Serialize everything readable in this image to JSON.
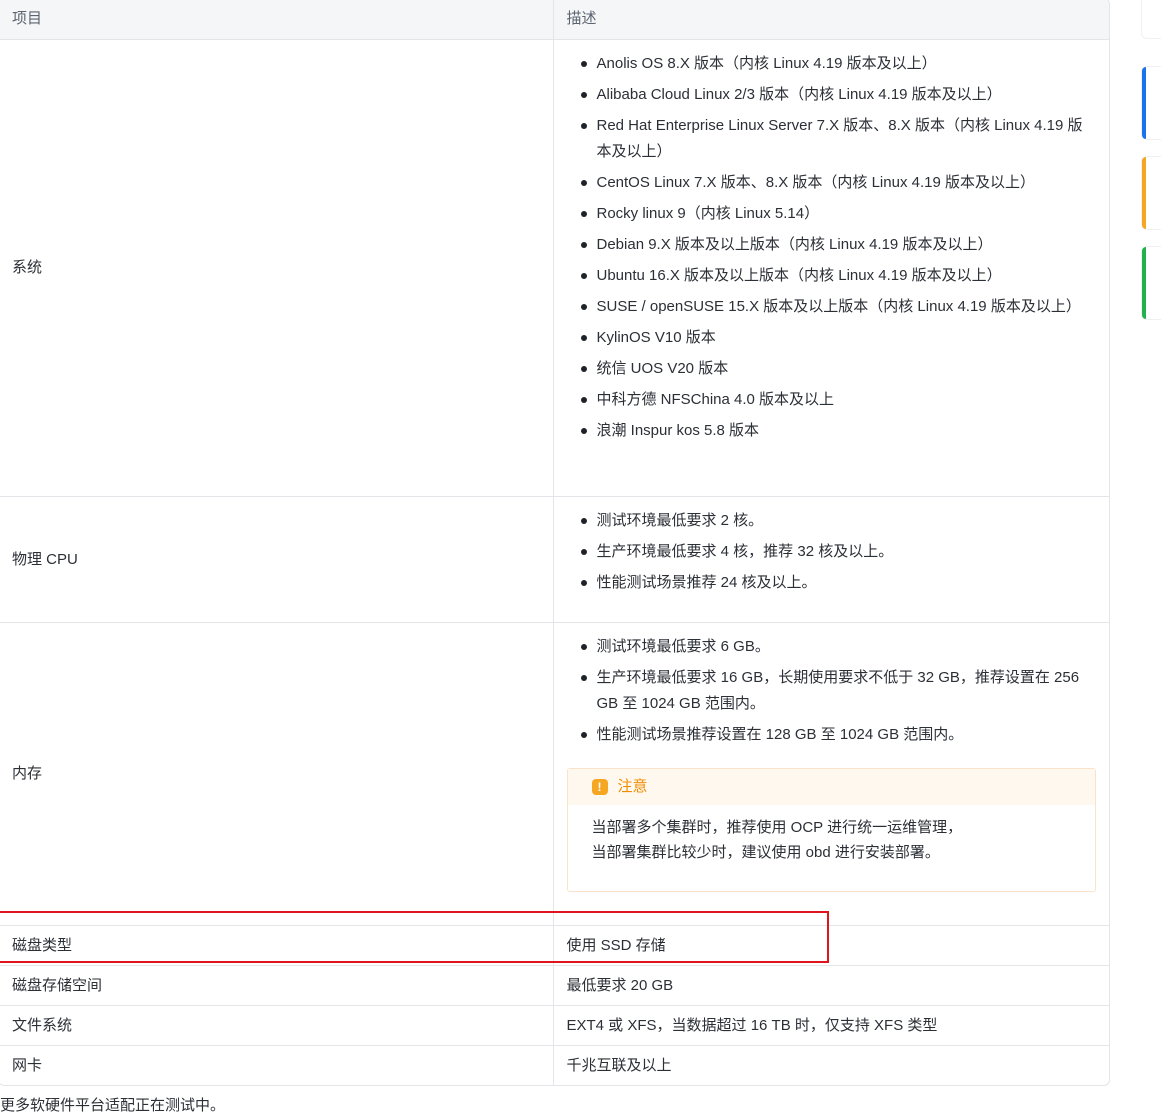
{
  "table": {
    "headers": [
      "项目",
      "描述"
    ],
    "system": {
      "label": "系统",
      "items": [
        "Anolis OS 8.X 版本（内核 Linux 4.19 版本及以上）",
        "Alibaba Cloud Linux 2/3 版本（内核 Linux 4.19 版本及以上）",
        "Red Hat Enterprise Linux Server 7.X 版本、8.X 版本（内核 Linux 4.19 版本及以上）",
        "CentOS Linux 7.X 版本、8.X 版本（内核 Linux 4.19 版本及以上）",
        "Rocky linux 9（内核 Linux 5.14）",
        "Debian 9.X 版本及以上版本（内核 Linux 4.19 版本及以上）",
        "Ubuntu 16.X 版本及以上版本（内核 Linux 4.19 版本及以上）",
        "SUSE / openSUSE 15.X 版本及以上版本（内核 Linux 4.19 版本及以上）",
        "KylinOS V10 版本",
        "统信 UOS V20 版本",
        "中科方德 NFSChina 4.0 版本及以上",
        "浪潮 Inspur kos 5.8 版本"
      ]
    },
    "cpu": {
      "label": "物理 CPU",
      "items": [
        "测试环境最低要求 2 核。",
        "生产环境最低要求 4 核，推荐 32 核及以上。",
        "性能测试场景推荐 24 核及以上。"
      ]
    },
    "memory": {
      "label": "内存",
      "items": [
        "测试环境最低要求 6 GB。",
        "生产环境最低要求 16 GB，长期使用要求不低于 32 GB，推荐设置在 256 GB 至 1024 GB 范围内。",
        "性能测试场景推荐设置在 128 GB 至 1024 GB 范围内。"
      ],
      "notice": {
        "title": "注意",
        "icon": "!",
        "lines": [
          "当部署多个集群时，推荐使用 OCP 进行统一运维管理，",
          "当部署集群比较少时，建议使用 obd 进行安装部署。"
        ]
      }
    },
    "simple_rows": [
      {
        "label": "磁盘类型",
        "value": "使用 SSD 存储"
      },
      {
        "label": "磁盘存储空间",
        "value": "最低要求 20 GB"
      },
      {
        "label": "文件系统",
        "value": "EXT4 或 XFS，当数据超过 16 TB 时，仅支持 XFS 类型"
      },
      {
        "label": "网卡",
        "value": "千兆互联及以上"
      }
    ]
  },
  "footer": "更多软硬件平台适配正在测试中。",
  "colors": {
    "highlight": "#e0141e",
    "notice_accent": "#f08c00",
    "side_blue": "#1a73e8",
    "side_orange": "#f5a623",
    "side_green": "#22b14c"
  }
}
